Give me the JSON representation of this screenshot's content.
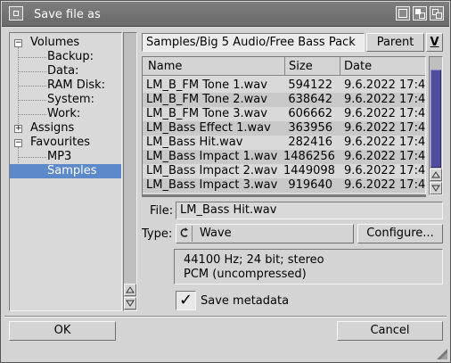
{
  "window": {
    "title": "Save file as"
  },
  "tree": {
    "items": [
      {
        "label": "Volumes",
        "expander": "−"
      },
      {
        "label": "Backup:"
      },
      {
        "label": "Data:"
      },
      {
        "label": "RAM Disk:"
      },
      {
        "label": "System:"
      },
      {
        "label": "Work:"
      },
      {
        "label": "Assigns",
        "expander": "+"
      },
      {
        "label": "Favourites",
        "expander": "−"
      },
      {
        "label": "MP3"
      },
      {
        "label": "Samples",
        "selected": true
      }
    ]
  },
  "path_bar": {
    "path": "Samples/Big 5 Audio/Free Bass Pack",
    "parent_label": "Parent",
    "dropdown_glyph": "V"
  },
  "file_list": {
    "columns": [
      "Name",
      "Size",
      "Date"
    ],
    "rows": [
      {
        "name": "LM_B_FM Tone 1.wav",
        "size": "594122",
        "date": "9.6.2022 17:4"
      },
      {
        "name": "LM_B_FM Tone 2.wav",
        "size": "638642",
        "date": "9.6.2022 17:4"
      },
      {
        "name": "LM_B_FM Tone 3.wav",
        "size": "606662",
        "date": "9.6.2022 17:4"
      },
      {
        "name": "LM_Bass Effect 1.wav",
        "size": "363956",
        "date": "9.6.2022 17:4"
      },
      {
        "name": "LM_Bass Hit.wav",
        "size": "282416",
        "date": "9.6.2022 17:4"
      },
      {
        "name": "LM_Bass Impact 1.wav",
        "size": "1486256",
        "date": "9.6.2022 17:4"
      },
      {
        "name": "LM_Bass Impact 2.wav",
        "size": "1449098",
        "date": "9.6.2022 17:4"
      },
      {
        "name": "LM_Bass Impact 3.wav",
        "size": "919640",
        "date": "9.6.2022 17:4"
      }
    ]
  },
  "form": {
    "file_label": "File:",
    "file_value": "LM_Bass Hit.wav",
    "type_label": "Type:",
    "type_value": "Wave",
    "configure_label": "Configure...",
    "info_line1": "44100 Hz; 24 bit; stereo",
    "info_line2": "PCM (uncompressed)",
    "save_metadata_label": "Save metadata",
    "save_metadata_checked": true,
    "check_glyph": "✓"
  },
  "footer": {
    "ok_label": "OK",
    "cancel_label": "Cancel"
  }
}
